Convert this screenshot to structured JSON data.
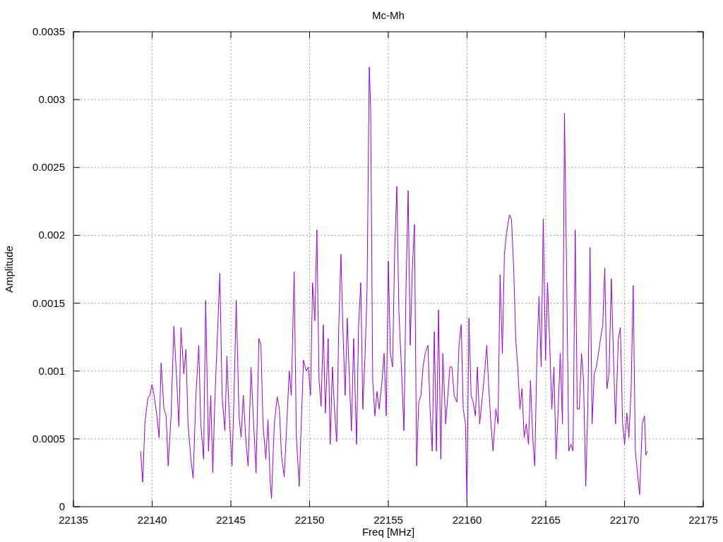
{
  "chart": {
    "chart_data": {
      "type": "line",
      "title": "Mc-Mh",
      "xlabel": "Freq [MHz]",
      "ylabel": "Amplitude",
      "grid": true,
      "xlim": [
        22135,
        22175
      ],
      "ylim": [
        0,
        0.0035
      ],
      "xticks": [
        22135,
        22140,
        22145,
        22150,
        22155,
        22160,
        22165,
        22170,
        22175
      ],
      "yticks": [
        0,
        0.0005,
        0.001,
        0.0015,
        0.002,
        0.0025,
        0.003,
        0.0035
      ],
      "x": [
        22139.27,
        22139.4,
        22139.54,
        22139.72,
        22139.85,
        22139.99,
        22140.12,
        22140.3,
        22140.44,
        22140.57,
        22140.75,
        22140.89,
        22141.02,
        22141.2,
        22141.38,
        22141.56,
        22141.7,
        22141.83,
        22142.01,
        22142.15,
        22142.28,
        22142.46,
        22142.6,
        22142.78,
        22142.96,
        22143.09,
        22143.27,
        22143.4,
        22143.58,
        22143.72,
        22143.85,
        22143.99,
        22144.12,
        22144.3,
        22144.44,
        22144.62,
        22144.75,
        22144.89,
        22145.07,
        22145.2,
        22145.34,
        22145.52,
        22145.65,
        22145.79,
        22145.97,
        22146.1,
        22146.28,
        22146.42,
        22146.6,
        22146.78,
        22146.91,
        22147.04,
        22147.22,
        22147.36,
        22147.49,
        22147.58,
        22147.76,
        22147.94,
        22148.08,
        22148.21,
        22148.39,
        22148.53,
        22148.71,
        22148.84,
        22149.02,
        22149.16,
        22149.34,
        22149.47,
        22149.61,
        22149.79,
        22149.92,
        22150.06,
        22150.19,
        22150.33,
        22150.46,
        22150.6,
        22150.73,
        22150.87,
        22151.0,
        22151.18,
        22151.31,
        22151.45,
        22151.58,
        22151.72,
        22151.85,
        22151.99,
        22152.12,
        22152.26,
        22152.39,
        22152.53,
        22152.66,
        22152.8,
        22152.98,
        22153.11,
        22153.25,
        22153.38,
        22153.52,
        22153.65,
        22153.79,
        22153.88,
        22154.01,
        22154.15,
        22154.28,
        22154.42,
        22154.6,
        22154.73,
        22154.87,
        22155.0,
        22155.13,
        22155.27,
        22155.4,
        22155.54,
        22155.67,
        22155.81,
        22155.99,
        22156.12,
        22156.26,
        22156.39,
        22156.53,
        22156.66,
        22156.8,
        22156.93,
        22157.07,
        22157.2,
        22157.34,
        22157.52,
        22157.65,
        22157.79,
        22157.92,
        22158.06,
        22158.19,
        22158.33,
        22158.46,
        22158.64,
        22158.78,
        22158.91,
        22159.04,
        22159.18,
        22159.36,
        22159.49,
        22159.63,
        22159.76,
        22159.9,
        22159.99,
        22160.12,
        22160.26,
        22160.39,
        22160.53,
        22160.66,
        22160.8,
        22160.98,
        22161.11,
        22161.25,
        22161.38,
        22161.52,
        22161.65,
        22161.83,
        22161.97,
        22162.1,
        22162.24,
        22162.37,
        22162.51,
        22162.69,
        22162.82,
        22162.96,
        22163.09,
        22163.22,
        22163.36,
        22163.49,
        22163.63,
        22163.76,
        22163.9,
        22164.03,
        22164.17,
        22164.3,
        22164.44,
        22164.57,
        22164.71,
        22164.84,
        22164.98,
        22165.11,
        22165.25,
        22165.38,
        22165.52,
        22165.65,
        22165.79,
        22165.92,
        22166.06,
        22166.19,
        22166.33,
        22166.46,
        22166.6,
        22166.73,
        22166.87,
        22167.0,
        22167.13,
        22167.27,
        22167.4,
        22167.54,
        22167.67,
        22167.81,
        22167.94,
        22168.08,
        22168.21,
        22168.35,
        22168.48,
        22168.62,
        22168.75,
        22168.89,
        22169.02,
        22169.16,
        22169.29,
        22169.43,
        22169.61,
        22169.74,
        22169.88,
        22170.01,
        22170.15,
        22170.28,
        22170.42,
        22170.55,
        22170.69,
        22170.82,
        22170.96,
        22171.13,
        22171.27,
        22171.36,
        22171.45
      ],
      "series": [
        {
          "color": "#9400d3",
          "values": [
            0.00041,
            0.00018,
            0.00061,
            0.0008,
            0.00082,
            0.0009,
            0.00082,
            0.00067,
            0.00051,
            0.00106,
            0.00072,
            0.00067,
            0.0003,
            0.00067,
            0.00133,
            0.00093,
            0.00059,
            0.00132,
            0.00098,
            0.00116,
            0.00061,
            0.00035,
            0.00021,
            0.00082,
            0.00119,
            0.00061,
            0.00035,
            0.00152,
            0.00041,
            0.00082,
            0.00025,
            0.00082,
            0.00119,
            0.00172,
            0.00082,
            0.00056,
            0.00111,
            0.00069,
            0.0003,
            0.00082,
            0.00152,
            0.00067,
            0.00051,
            0.00082,
            0.00046,
            0.0003,
            0.00103,
            0.00067,
            0.00025,
            0.00124,
            0.00119,
            0.00061,
            0.00035,
            0.00064,
            0.0002,
            6e-05,
            0.00061,
            0.00081,
            0.00072,
            0.00038,
            0.00022,
            0.00056,
            0.001,
            0.00082,
            0.00173,
            0.00051,
            0.00015,
            0.00061,
            0.00108,
            0.001,
            0.00103,
            0.00082,
            0.00165,
            0.00137,
            0.00204,
            0.00093,
            0.00074,
            0.00134,
            0.00069,
            0.00124,
            0.00046,
            0.00103,
            0.00072,
            0.00048,
            0.00132,
            0.00186,
            0.00129,
            0.00082,
            0.00139,
            0.00093,
            0.00056,
            0.00124,
            0.00046,
            0.00134,
            0.00165,
            0.00072,
            0.00111,
            0.0016,
            0.00324,
            0.00292,
            0.00093,
            0.00067,
            0.00085,
            0.00072,
            0.00093,
            0.00113,
            0.00067,
            0.00181,
            0.00113,
            0.00103,
            0.00186,
            0.00236,
            0.00145,
            0.00108,
            0.00056,
            0.0016,
            0.00233,
            0.00119,
            0.00176,
            0.00208,
            0.0003,
            0.00077,
            0.00082,
            0.00103,
            0.00113,
            0.00119,
            0.00072,
            0.00041,
            0.00129,
            0.00041,
            0.00145,
            0.00035,
            0.00113,
            0.00061,
            0.00082,
            0.00103,
            0.00103,
            0.00082,
            0.00077,
            0.00119,
            0.00134,
            0.00072,
            0.00061,
            4e-05,
            0.00139,
            0.00082,
            0.00077,
            0.00067,
            0.00103,
            0.00061,
            0.00082,
            0.00098,
            0.00119,
            0.00087,
            0.00061,
            0.00041,
            0.00072,
            0.00061,
            0.00171,
            0.00113,
            0.00186,
            0.00202,
            0.00215,
            0.00212,
            0.00176,
            0.00124,
            0.00103,
            0.00072,
            0.00087,
            0.00051,
            0.00061,
            0.00046,
            0.00093,
            0.00051,
            0.0003,
            0.00113,
            0.00155,
            0.00103,
            0.00212,
            0.00108,
            0.00165,
            0.00119,
            0.00072,
            0.00103,
            0.00035,
            0.00072,
            0.00113,
            0.00061,
            0.0029,
            0.00165,
            0.00041,
            0.00046,
            0.00041,
            0.00204,
            0.00072,
            0.00072,
            0.00113,
            0.00093,
            0.00015,
            0.00072,
            0.00191,
            0.00061,
            0.00098,
            0.00103,
            0.00113,
            0.00124,
            0.00134,
            0.00176,
            0.00087,
            0.00098,
            0.00168,
            0.00113,
            0.00061,
            0.00124,
            0.00132,
            0.00061,
            0.00046,
            0.00069,
            0.00051,
            0.00087,
            0.00163,
            0.00041,
            0.00025,
            9e-05,
            0.00061,
            0.00067,
            0.00038,
            0.00041
          ]
        }
      ]
    }
  }
}
